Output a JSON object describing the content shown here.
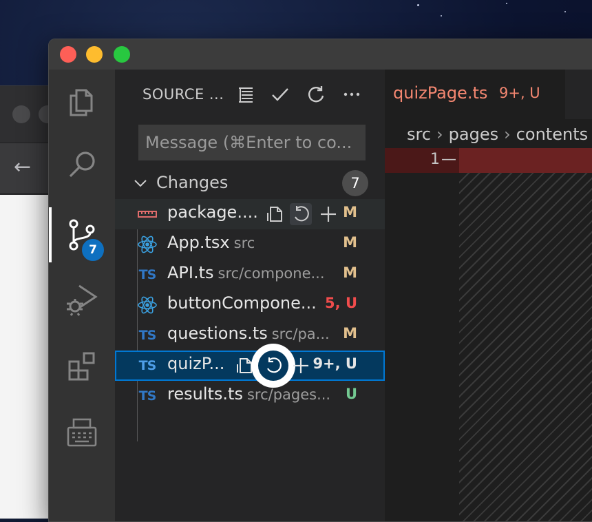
{
  "colors": {
    "accent": "#0e70c0",
    "modified": "#e2c08d",
    "untracked": "#73c991",
    "error": "#f48771",
    "selected_bg": "#04395e"
  },
  "background_window": {
    "back_icon": "arrow-left-icon"
  },
  "window": {
    "controls": [
      "close",
      "minimize",
      "maximize"
    ]
  },
  "activity_bar": {
    "items": [
      {
        "name": "explorer",
        "icon": "files-icon"
      },
      {
        "name": "search",
        "icon": "search-icon"
      },
      {
        "name": "source-control",
        "icon": "source-control-icon",
        "badge": "7"
      },
      {
        "name": "run-debug",
        "icon": "run-debug-icon"
      },
      {
        "name": "extensions",
        "icon": "extensions-icon"
      },
      {
        "name": "remote",
        "icon": "typewriter-icon"
      }
    ]
  },
  "sidebar": {
    "title": "SOURCE ...",
    "actions": [
      "view-as-tree-icon",
      "commit-check-icon",
      "refresh-icon",
      "more-icon"
    ],
    "message_placeholder": "Message (⌘Enter to co...",
    "changes_label": "Changes",
    "changes_count": "7",
    "files": [
      {
        "icon": "ruler",
        "name": "package....",
        "dir": "",
        "status": "M",
        "status_type": "m"
      },
      {
        "icon": "react",
        "name": "App.tsx",
        "dir": "src",
        "status": "M",
        "status_type": "m"
      },
      {
        "icon": "TS",
        "name": "API.ts",
        "dir": "src/compone...",
        "status": "M",
        "status_type": "m"
      },
      {
        "icon": "react",
        "name": "buttonCompone...",
        "dir": "",
        "status": "5, U",
        "status_type": "err"
      },
      {
        "icon": "TS",
        "name": "questions.ts",
        "dir": "src/pa...",
        "status": "M",
        "status_type": "m"
      },
      {
        "icon": "TS",
        "name": "quizP...",
        "dir": "",
        "status": "9+, U",
        "status_type": "sel"
      },
      {
        "icon": "TS",
        "name": "results.ts",
        "dir": "src/pages...",
        "status": "U",
        "status_type": "u"
      }
    ]
  },
  "editor": {
    "tab": {
      "name": "quizPage.ts",
      "status": "9+, U"
    },
    "breadcrumbs": [
      "src",
      "pages",
      "contents"
    ],
    "line_number": "1",
    "line_marker": "—"
  }
}
